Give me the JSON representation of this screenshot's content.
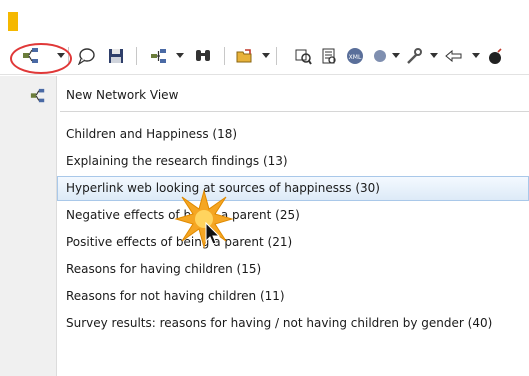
{
  "menu": {
    "header_item": "New Network View",
    "items": [
      "Children and Happiness (18)",
      "Explaining the research findings (13)",
      "Hyperlink web looking at sources of happinesss (30)",
      "Negative effects of being a parent (25)",
      "Positive effects of being a parent (21)",
      "Reasons for having children (15)",
      "Reasons for not having children (11)",
      "Survey results: reasons for having / not having children by gender (40)"
    ],
    "hovered_index": 2
  },
  "toolbar": {
    "icons": [
      "network-view-icon",
      "dropdown-arrow-icon",
      "comment-icon",
      "save-icon",
      "code-manager-icon",
      "dropdown-arrow-icon",
      "binoculars-icon",
      "folder-open-icon",
      "dropdown-arrow-icon",
      "query-tool-icon",
      "word-cruncher-icon",
      "xml-icon",
      "dropdown-arrow-icon",
      "wrench-icon",
      "dropdown-arrow-icon",
      "back-arrow-icon",
      "dropdown-arrow-icon",
      "bomb-icon"
    ]
  },
  "colors": {
    "accent": "#f5b800",
    "highlight_ring": "#e03838",
    "hover_border": "#a9c8e9"
  }
}
